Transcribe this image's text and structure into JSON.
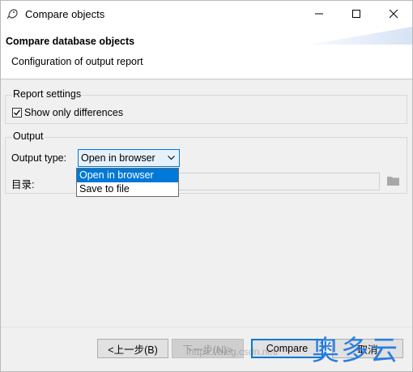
{
  "window": {
    "title": "Compare objects"
  },
  "banner": {
    "title": "Compare database objects",
    "subtitle": "Configuration of output report"
  },
  "report_settings": {
    "label": "Report settings",
    "show_only_differences": {
      "label": "Show only differences",
      "checked": true
    }
  },
  "output": {
    "label": "Output",
    "output_type_label": "Output type:",
    "selected": "Open in browser",
    "options": [
      "Open in browser",
      "Save to file"
    ],
    "directory_label": "目录:",
    "directory_value": ""
  },
  "buttons": {
    "back": "<上一步(B)",
    "next": "下一步(N)>",
    "compare": "Compare",
    "cancel": "取消"
  },
  "overlay": {
    "watermark": "https://blog.csdn.net/",
    "logo": "奥多云"
  },
  "colors": {
    "accent": "#0078d7",
    "logo": "#2a7de1"
  }
}
